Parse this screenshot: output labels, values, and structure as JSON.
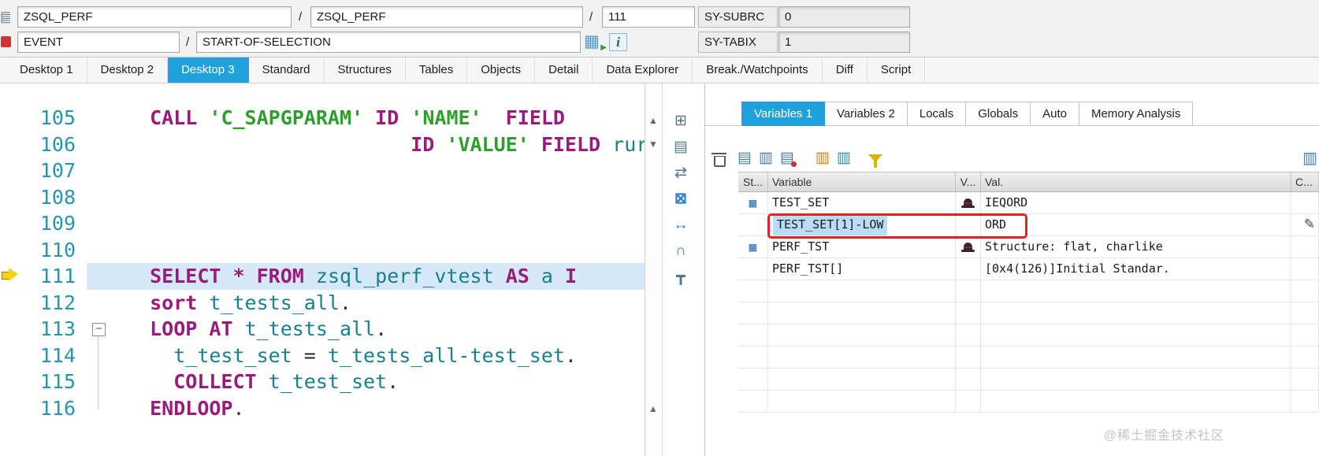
{
  "header": {
    "program": "ZSQL_PERF",
    "include": "ZSQL_PERF",
    "line": "111",
    "slash": "/",
    "sy_subrc_label": "SY-SUBRC",
    "sy_subrc_value": "0",
    "event_label": "EVENT",
    "event_value": "START-OF-SELECTION",
    "sy_tabix_label": "SY-TABIX",
    "sy_tabix_value": "1"
  },
  "desktop_tabs": {
    "items": [
      "Desktop 1",
      "Desktop 2",
      "Desktop 3",
      "Standard",
      "Structures",
      "Tables",
      "Objects",
      "Detail",
      "Data Explorer",
      "Break./Watchpoints",
      "Diff",
      "Script"
    ],
    "active": "Desktop 3"
  },
  "editor": {
    "lines": [
      {
        "num": "105",
        "s0": "  ",
        "s1": "CALL",
        "s2": " ",
        "s3": "'C_SAPGPARAM'",
        "s4": " ",
        "s5": "ID",
        "s6": " ",
        "s7": "'NAME'",
        "s8": "  ",
        "s9": "FIELD"
      },
      {
        "num": "106",
        "s0": "                        ",
        "s1": "ID",
        "s2": " ",
        "s3": "'VALUE'",
        "s4": " ",
        "s5": "FIELD",
        "s6": " ",
        "s7": "rur"
      },
      {
        "num": "107"
      },
      {
        "num": "108"
      },
      {
        "num": "109"
      },
      {
        "num": "110"
      },
      {
        "num": "111",
        "s0": "  ",
        "s1": "SELECT",
        "s2": " ",
        "s3": "*",
        "s4": " ",
        "s5": "FROM",
        "s6": " ",
        "s7": "zsql_perf_vtest",
        "s8": " ",
        "s9": "AS",
        "s10": " ",
        "s11": "a",
        "s12": " ",
        "s13": "I"
      },
      {
        "num": "112",
        "s0": "  ",
        "s1": "sort",
        "s2": " ",
        "s3": "t_tests_all",
        "s4": "."
      },
      {
        "num": "113",
        "s0": "  ",
        "s1": "LOOP",
        "s2": " ",
        "s3": "AT",
        "s4": " ",
        "s5": "t_tests_all",
        "s6": "."
      },
      {
        "num": "114",
        "s0": "    ",
        "s1": "t_test_set",
        "s2": " = ",
        "s3": "t_tests_all-test_set",
        "s4": "."
      },
      {
        "num": "115",
        "s0": "    ",
        "s1": "COLLECT",
        "s2": " ",
        "s3": "t_test_set",
        "s4": "."
      },
      {
        "num": "116",
        "s0": "  ",
        "s1": "ENDLOOP",
        "s2": "."
      }
    ]
  },
  "right": {
    "tabs": [
      "Variables 1",
      "Variables 2",
      "Locals",
      "Globals",
      "Auto",
      "Memory Analysis"
    ],
    "active_tab": "Variables 1",
    "table": {
      "headers": {
        "st": "St...",
        "variable": "Variable",
        "v": "V...",
        "val": "Val.",
        "c": "C..."
      },
      "rows": [
        {
          "variable": "TEST_SET",
          "val": "IEQORD"
        },
        {
          "variable": "TEST_SET[1]-LOW",
          "val": "ORD"
        },
        {
          "variable": "PERF_TST",
          "val": "Structure: flat, charlike"
        },
        {
          "variable": "PERF_TST[]",
          "val": "[0x4(126)]Initial Standar."
        }
      ]
    }
  },
  "icons": {
    "info": "i",
    "goto_grid": "▦",
    "goto_arrow": "▶",
    "window": "▤",
    "scroll_up": "▲",
    "scroll_down": "▼",
    "strip_table": "⊞",
    "strip_doc": "▤",
    "strip_swap": "⇄",
    "strip_close": "⊠",
    "strip_resize": "↔",
    "strip_watch": "∩",
    "strip_tree": "┳",
    "tool_edit": "▤",
    "tool_rows": "▥",
    "tool_del": "▤",
    "tool_seq": "▥",
    "tool_swapcol": "▥",
    "layout": "▥",
    "row_table": "▦",
    "pencil": "✎"
  },
  "colors": {
    "active_tab": "#1fa2dc",
    "keyword": "#991c7a",
    "string": "#2f9e2f",
    "identifier": "#1b7f8f",
    "current_line_bg": "#d6e9f8",
    "selection_bg": "#b9dcf7",
    "annotation_red": "#e42222"
  },
  "watermark": "@稀土掘金技术社区"
}
